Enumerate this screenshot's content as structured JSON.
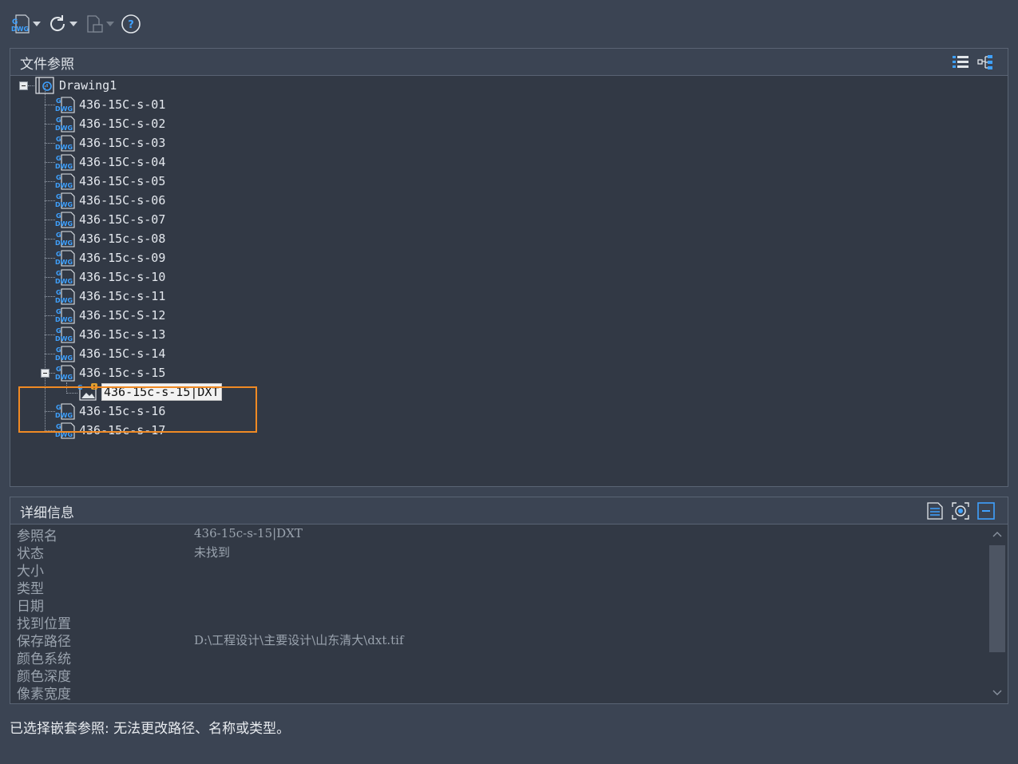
{
  "toolbar": {
    "buttons": [
      {
        "name": "attach-dwg",
        "icon": "dwg-attach-icon",
        "has_dropdown": true
      },
      {
        "name": "refresh",
        "icon": "refresh-icon",
        "has_dropdown": true
      },
      {
        "name": "change-path",
        "icon": "change-path-icon",
        "has_dropdown": true,
        "disabled": true
      },
      {
        "name": "help",
        "icon": "help-icon",
        "has_dropdown": false
      }
    ]
  },
  "references_panel": {
    "title": "文件参照",
    "view_icons": [
      "list-view-icon",
      "tree-view-icon"
    ],
    "root": "Drawing1",
    "items": [
      "436-15C-s-01",
      "436-15C-s-02",
      "436-15C-s-03",
      "436-15C-s-04",
      "436-15C-s-05",
      "436-15C-s-06",
      "436-15C-s-07",
      "436-15c-s-08",
      "436-15c-s-09",
      "436-15c-s-10",
      "436-15c-s-11",
      "436-15C-S-12",
      "436-15c-s-13",
      "436-15C-s-14",
      "436-15c-s-15"
    ],
    "nested_child": "436-15c-s-15|DXT",
    "items_after": [
      "436-15c-s-16",
      "436-15c-s-17"
    ],
    "status_badge": "!"
  },
  "details_panel": {
    "title": "详细信息",
    "header_icons": [
      "details-icon",
      "preview-icon",
      "collapse-icon"
    ],
    "rows": [
      {
        "key": "参照名",
        "value": "436-15c-s-15|DXT"
      },
      {
        "key": "状态",
        "value": "未找到"
      },
      {
        "key": "大小",
        "value": ""
      },
      {
        "key": "类型",
        "value": ""
      },
      {
        "key": "日期",
        "value": ""
      },
      {
        "key": "找到位置",
        "value": ""
      },
      {
        "key": "保存路径",
        "value": "D:\\工程设计\\主要设计\\山东清大\\dxt.tif"
      },
      {
        "key": "颜色系统",
        "value": ""
      },
      {
        "key": "颜色深度",
        "value": ""
      },
      {
        "key": "像素宽度",
        "value": ""
      }
    ]
  },
  "status_message": "已选择嵌套参照: 无法更改路径、名称或类型。",
  "colors": {
    "accent_highlight": "#f08a24",
    "dwg_icon_blue": "#3fa1ff",
    "background": "#3b4453",
    "panel": "#323945"
  }
}
